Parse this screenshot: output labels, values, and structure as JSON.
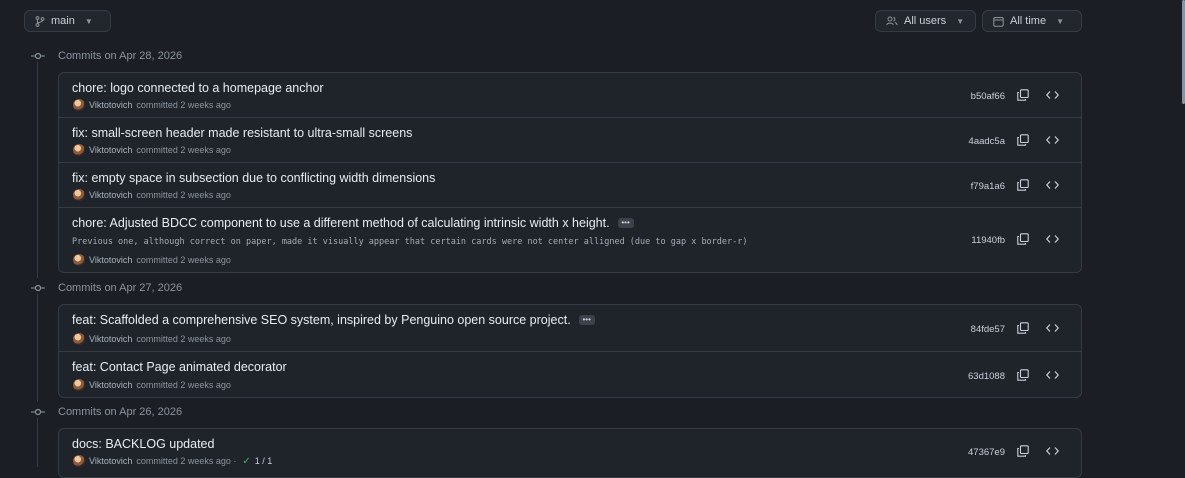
{
  "toolbar": {
    "branch": "main",
    "users_filter": "All users",
    "time_filter": "All time"
  },
  "groups": [
    {
      "date_label": "Commits on Apr 28, 2026",
      "commits": [
        {
          "title": "chore: logo connected to a homepage anchor",
          "author": "Viktotovich",
          "time": "committed 2 weeks ago",
          "sha": "b50af66"
        },
        {
          "title": "fix: small-screen header made resistant to ultra-small screens",
          "author": "Viktotovich",
          "time": "committed 2 weeks ago",
          "sha": "4aadc5a"
        },
        {
          "title": "fix: empty space in subsection due to conflicting width dimensions",
          "author": "Viktotovich",
          "time": "committed 2 weeks ago",
          "sha": "f79a1a6"
        },
        {
          "title": "chore: Adjusted BDCC component to use a different method of calculating intrinsic width x height.",
          "ellipsis": "•••",
          "description": "Previous one, although correct on paper, made it visually appear that certain cards were not center alligned (due to gap x border-r)",
          "author": "Viktotovich",
          "time": "committed 2 weeks ago",
          "sha": "11940fb"
        }
      ]
    },
    {
      "date_label": "Commits on Apr 27, 2026",
      "commits": [
        {
          "title": "feat: Scaffolded a comprehensive SEO system, inspired by Penguino open source project.",
          "ellipsis": "•••",
          "author": "Viktotovich",
          "time": "committed 2 weeks ago",
          "sha": "84fde57"
        },
        {
          "title": "feat: Contact Page animated decorator",
          "author": "Viktotovich",
          "time": "committed 2 weeks ago",
          "sha": "63d1088"
        }
      ]
    },
    {
      "date_label": "Commits on Apr 26, 2026",
      "commits": [
        {
          "title": "docs: BACKLOG updated",
          "author": "Viktotovich",
          "time": "committed 2 weeks ago ·",
          "checks": "1 / 1",
          "sha": "47367e9"
        }
      ]
    }
  ],
  "icons": {
    "branch": "git-branch-icon",
    "users": "people-icon",
    "calendar": "calendar-icon",
    "commit_node": "git-commit-icon",
    "copy": "copy-icon",
    "browse": "code-icon",
    "check": "check-icon"
  },
  "colors": {
    "background": "#1b1f25",
    "panel": "#1f242b",
    "border": "#343b45",
    "text": "#e6edf3",
    "muted": "#8b949e",
    "success": "#3fb950"
  }
}
